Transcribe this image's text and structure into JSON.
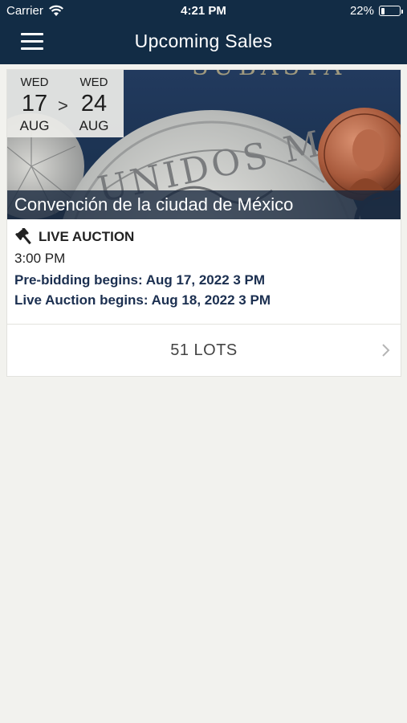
{
  "status_bar": {
    "carrier": "Carrier",
    "time": "4:21 PM",
    "battery": "22%",
    "battery_level": 0.22
  },
  "header": {
    "title": "Upcoming Sales",
    "menu_icon": "hamburger-menu-icon"
  },
  "sale": {
    "start": {
      "weekday": "WED",
      "day": "17",
      "month": "AUG"
    },
    "separator": ">",
    "end": {
      "weekday": "WED",
      "day": "24",
      "month": "AUG"
    },
    "title": "Convención de la ciudad de México",
    "type_icon": "gavel-icon",
    "type_label": "LIVE AUCTION",
    "time": "3:00 PM",
    "prebid": "Pre-bidding begins: Aug 17, 2022 3 PM",
    "live": "Live Auction begins: Aug 18, 2022 3 PM",
    "lots_label": "51 LOTS",
    "chevron_icon": "chevron-right-icon"
  },
  "colors": {
    "header_bg": "#122c45",
    "page_bg": "#f2f2ee",
    "accent_text": "#1b2f50"
  }
}
